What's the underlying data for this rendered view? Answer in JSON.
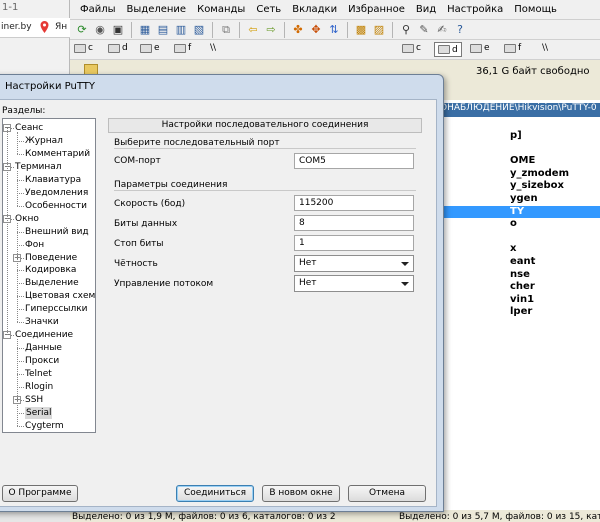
{
  "browser": {
    "title_fragment": "1-1",
    "tab_text": "iner.by",
    "tab_text2": "Ян"
  },
  "tc": {
    "menu": [
      "Файлы",
      "Выделение",
      "Команды",
      "Сеть",
      "Вкладки",
      "Избранное",
      "Вид",
      "Настройка",
      "Помощь"
    ],
    "left_drives": [
      {
        "letter": "c"
      },
      {
        "letter": "d"
      },
      {
        "letter": "e"
      },
      {
        "letter": "f"
      }
    ],
    "right_drives": [
      {
        "letter": "c"
      },
      {
        "letter": "d",
        "selected": true
      },
      {
        "letter": "e"
      },
      {
        "letter": "f"
      }
    ],
    "drive_sep": "\\\\",
    "free_space": "36,1 G байт свободно",
    "path": "ОНАБЛЮДЕНИЕ\\Hikvision\\PuTTY-0",
    "files": [
      "p]",
      "",
      "OME",
      "y_zmodem",
      "y_sizebox",
      "ygen",
      "TY",
      "o",
      "",
      "x",
      "eant",
      "nse",
      "cher",
      "vin1",
      "lper"
    ],
    "selected_file_index": 6,
    "status_left": "Выделено: 0 из 1,9 М, файлов: 0 из 6, каталогов: 0 из 2",
    "status_right": "Выделено: 0 из 5,7 М, файлов: 0 из 15, каталогов: 0"
  },
  "putty": {
    "title": "Настройки PuTTY",
    "categories_label": "Разделы:",
    "tree": [
      {
        "label": "Сеанс",
        "level": 0,
        "expanded": true
      },
      {
        "label": "Журнал",
        "level": 1
      },
      {
        "label": "Комментарий",
        "level": 1
      },
      {
        "label": "Терминал",
        "level": 0,
        "expanded": true
      },
      {
        "label": "Клавиатура",
        "level": 1
      },
      {
        "label": "Уведомления",
        "level": 1
      },
      {
        "label": "Особенности",
        "level": 1
      },
      {
        "label": "Окно",
        "level": 0,
        "expanded": true
      },
      {
        "label": "Внешний вид",
        "level": 1
      },
      {
        "label": "Фон",
        "level": 1
      },
      {
        "label": "Поведение",
        "level": 1,
        "collapsed": true
      },
      {
        "label": "Кодировка",
        "level": 1
      },
      {
        "label": "Выделение",
        "level": 1
      },
      {
        "label": "Цветовая схема",
        "level": 1
      },
      {
        "label": "Гиперссылки",
        "level": 1
      },
      {
        "label": "Значки",
        "level": 1
      },
      {
        "label": "Соединение",
        "level": 0,
        "expanded": true
      },
      {
        "label": "Данные",
        "level": 1
      },
      {
        "label": "Прокси",
        "level": 1
      },
      {
        "label": "Telnet",
        "level": 1
      },
      {
        "label": "Rlogin",
        "level": 1
      },
      {
        "label": "SSH",
        "level": 1,
        "collapsed": true
      },
      {
        "label": "Serial",
        "level": 1,
        "selected": true
      },
      {
        "label": "Cygterm",
        "level": 1
      }
    ],
    "panel_header": "Настройки последовательного соединения",
    "group1_label": "Выберите последовательный порт",
    "com_port_label": "COM-порт",
    "com_port_value": "COM5",
    "group2_label": "Параметры соединения",
    "speed_label": "Скорость (бод)",
    "speed_value": "115200",
    "data_bits_label": "Биты данных",
    "data_bits_value": "8",
    "stop_bits_label": "Стоп биты",
    "stop_bits_value": "1",
    "parity_label": "Чётность",
    "parity_value": "Нет",
    "flow_label": "Управление потоком",
    "flow_value": "Нет",
    "about_button": "О Программе",
    "connect_button": "Соединиться",
    "new_window_button": "В новом окне",
    "cancel_button": "Отмена"
  }
}
